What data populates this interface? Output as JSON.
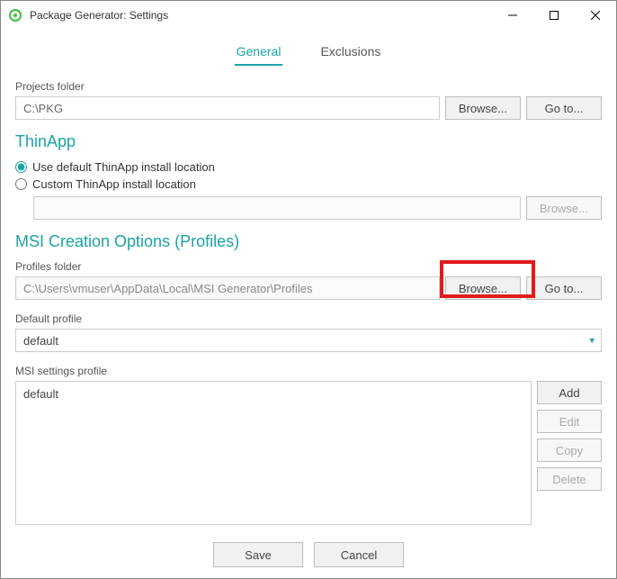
{
  "window": {
    "title": "Package Generator: Settings"
  },
  "tabs": {
    "general": "General",
    "exclusions": "Exclusions"
  },
  "projects": {
    "label": "Projects folder",
    "value": "C:\\PKG",
    "browse": "Browse...",
    "goto": "Go to..."
  },
  "thinapp": {
    "title": "ThinApp",
    "use_default": "Use default ThinApp install location",
    "custom": "Custom ThinApp install location",
    "path": "",
    "browse": "Browse..."
  },
  "msi": {
    "title": "MSI Creation Options (Profiles)",
    "profiles_label": "Profiles folder",
    "profiles_value": "C:\\Users\\vmuser\\AppData\\Local\\MSI Generator\\Profiles",
    "browse": "Browse...",
    "goto": "Go to...",
    "default_profile_label": "Default profile",
    "default_profile_value": "default",
    "settings_profile_label": "MSI settings profile",
    "list_item": "default",
    "add": "Add",
    "edit": "Edit",
    "copy": "Copy",
    "delete": "Delete"
  },
  "footer": {
    "save": "Save",
    "cancel": "Cancel"
  }
}
